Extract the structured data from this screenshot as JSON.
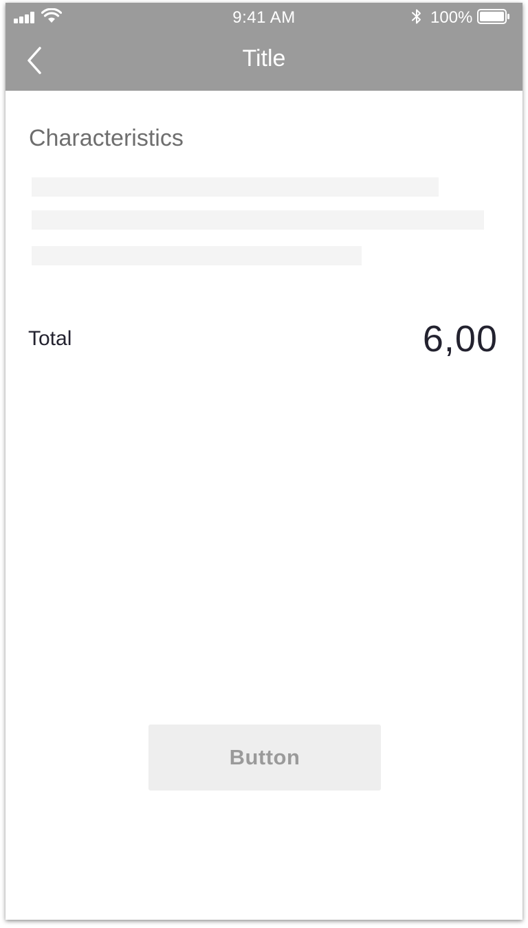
{
  "status_bar": {
    "time": "9:41 AM",
    "battery_percent": "100%",
    "icons": [
      "signal-icon",
      "wifi-icon",
      "bluetooth-icon",
      "battery-icon"
    ]
  },
  "nav": {
    "title": "Title",
    "back_icon": "chevron-left-icon"
  },
  "content": {
    "section_title": "Characteristics",
    "placeholder_lines": 3,
    "total_label": "Total",
    "total_value": "6,00"
  },
  "actions": {
    "button_label": "Button"
  },
  "colors": {
    "header_bg": "#9b9b9b",
    "text_dark": "#23222f",
    "text_muted": "#6e6e6e",
    "skeleton": "#f4f4f4",
    "button_bg": "#eeeeee",
    "button_text": "#9a9a9a"
  }
}
